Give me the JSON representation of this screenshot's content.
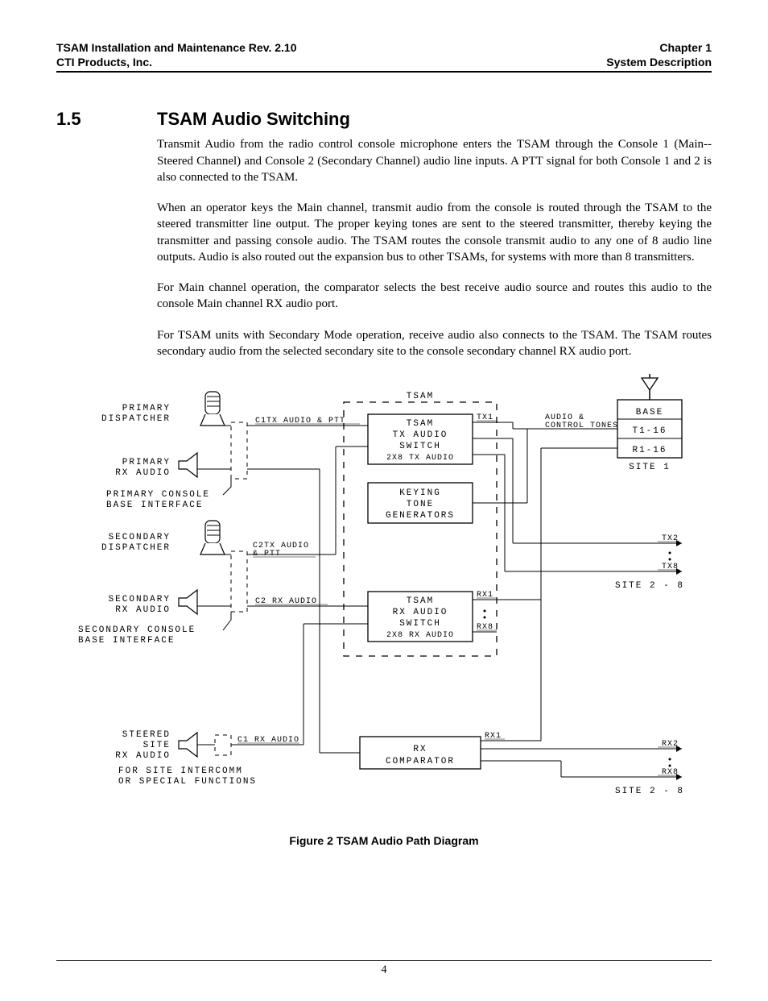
{
  "header": {
    "left_line1": "TSAM Installation and Maintenance Rev. 2.10",
    "left_line2": "CTI Products, Inc.",
    "right_line1": "Chapter 1",
    "right_line2": "System Description"
  },
  "section": {
    "number": "1.5",
    "title": "TSAM Audio Switching"
  },
  "paragraphs": {
    "p1": "Transmit Audio from the radio control console microphone enters the TSAM through the Console 1 (Main--Steered Channel) and Console 2 (Secondary Channel) audio line inputs.  A PTT signal for both Console 1 and 2 is also connected to the TSAM.",
    "p2": "When an operator keys the Main channel, transmit audio from the console is routed through the TSAM to the steered transmitter line output.  The proper keying tones are sent to the steered transmitter, thereby keying the transmitter and passing console audio.  The TSAM routes the console transmit audio to any one of 8 audio line outputs.  Audio is also routed out the expansion bus to other TSAMs, for systems with more than 8 transmitters.",
    "p3": "For Main channel operation, the comparator selects the best receive audio source and routes this audio to the console Main channel RX audio port.",
    "p4": "For TSAM units with Secondary Mode operation, receive audio also connects to the TSAM.  The TSAM routes secondary audio from the selected secondary site to the console secondary channel RX audio port."
  },
  "diagram": {
    "tsam_title": "TSAM",
    "tx_switch_l1": "TSAM",
    "tx_switch_l2": "TX AUDIO",
    "tx_switch_l3": "SWITCH",
    "tx_switch_l4": "2X8 TX AUDIO",
    "keying_l1": "KEYING",
    "keying_l2": "TONE",
    "keying_l3": "GENERATORS",
    "rx_switch_l1": "TSAM",
    "rx_switch_l2": "RX AUDIO",
    "rx_switch_l3": "SWITCH",
    "rx_switch_l4": "2X8 RX AUDIO",
    "rx_comp_l1": "RX",
    "rx_comp_l2": "COMPARATOR",
    "primary_disp_l1": "PRIMARY",
    "primary_disp_l2": "DISPATCHER",
    "primary_rx_l1": "PRIMARY",
    "primary_rx_l2": "RX AUDIO",
    "primary_cons_l1": "PRIMARY CONSOLE",
    "primary_cons_l2": "BASE INTERFACE",
    "secondary_disp_l1": "SECONDARY",
    "secondary_disp_l2": "DISPATCHER",
    "secondary_rx_l1": "SECONDARY",
    "secondary_rx_l2": "RX AUDIO",
    "secondary_cons_l1": "SECONDARY CONSOLE",
    "secondary_cons_l2": "BASE INTERFACE",
    "steered_l1": "STEERED",
    "steered_l2": "SITE",
    "steered_l3": "RX AUDIO",
    "steered_note_l1": "FOR SITE INTERCOMM",
    "steered_note_l2": "OR SPECIAL FUNCTIONS",
    "c1tx": "C1TX AUDIO & PTT",
    "c2tx_l1": "C2TX AUDIO",
    "c2tx_l2": "& PTT",
    "c2rx": "C2 RX AUDIO",
    "c1rx": "C1 RX AUDIO",
    "audio_control_l1": "AUDIO &",
    "audio_control_l2": "CONTROL TONES",
    "base": "BASE",
    "t116": "T1-16",
    "r116": "R1-16",
    "site1": "SITE 1",
    "tx1": "TX1",
    "tx2": "TX2",
    "tx8": "TX8",
    "site28a": "SITE 2 - 8",
    "rx1": "RX1",
    "rx8": "RX8",
    "rx2": "RX2",
    "rx8b": "RX8",
    "site28b": "SITE 2 - 8",
    "rx1b": "RX1"
  },
  "figure_caption": "Figure 2   TSAM Audio Path Diagram",
  "page_number": "4"
}
